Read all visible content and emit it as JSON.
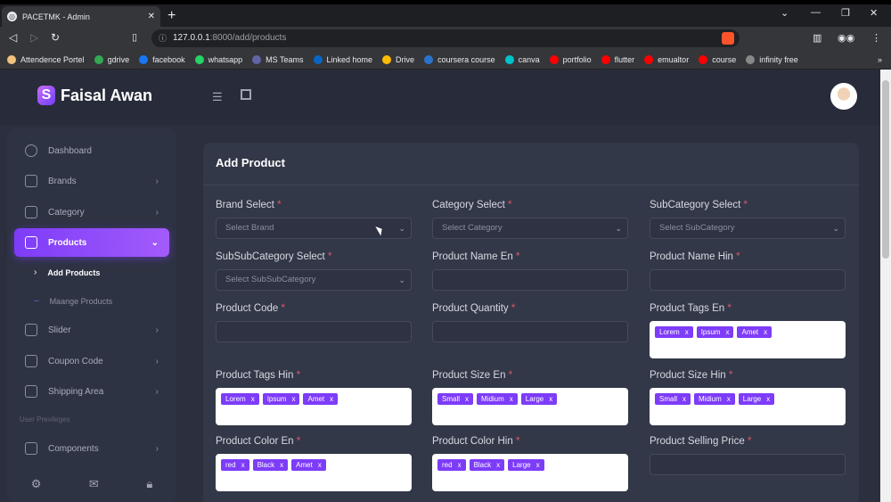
{
  "browser": {
    "tab_title": "PACETMK - Admin",
    "tab_close": "✕",
    "new_tab": "+",
    "url_host": "127.0.0.1",
    "url_path": ":8000/add/products",
    "bookmarks": [
      {
        "label": "Attendence Portel",
        "color": "#f0c27b"
      },
      {
        "label": "gdrive",
        "color": "#34a853"
      },
      {
        "label": "facebook",
        "color": "#1877f2"
      },
      {
        "label": "whatsapp",
        "color": "#25d366"
      },
      {
        "label": "MS Teams",
        "color": "#6264a7"
      },
      {
        "label": "Linked home",
        "color": "#0a66c2"
      },
      {
        "label": "Drive",
        "color": "#fbbc04"
      },
      {
        "label": "coursera course",
        "color": "#2a73cc"
      },
      {
        "label": "canva",
        "color": "#00c4cc"
      },
      {
        "label": "portfolio",
        "color": "#ff0000"
      },
      {
        "label": "flutter",
        "color": "#ff0000"
      },
      {
        "label": "emualtor",
        "color": "#ff0000"
      },
      {
        "label": "course",
        "color": "#ff0000"
      },
      {
        "label": "infinity free",
        "color": "#888888"
      }
    ],
    "more": "»"
  },
  "header": {
    "brand": "Faisal Awan",
    "logo_letter": "S"
  },
  "sidebar": {
    "items": [
      {
        "label": "Dashboard"
      },
      {
        "label": "Brands"
      },
      {
        "label": "Category"
      },
      {
        "label": "Products"
      },
      {
        "label": "Slider"
      },
      {
        "label": "Coupon Code"
      },
      {
        "label": "Shipping Area"
      },
      {
        "label": "Components"
      }
    ],
    "sub_items": [
      "Add Products",
      "Maange Products"
    ],
    "section_label": "User Previleges"
  },
  "form": {
    "title": "Add Product",
    "required_mark": "*",
    "brand_label": "Brand Select",
    "brand_placeholder": "Select Brand",
    "category_label": "Category Select",
    "category_placeholder": "Select Category",
    "subcategory_label": "SubCategory Select",
    "subcategory_placeholder": "Select SubCategory",
    "subsubcategory_label": "SubSubCategory Select",
    "subsubcategory_placeholder": "Select SubSubCategory",
    "name_en_label": "Product Name En",
    "name_hin_label": "Product Name Hin",
    "code_label": "Product Code",
    "quantity_label": "Product Quantity",
    "tags_en_label": "Product Tags En",
    "tags_en": [
      "Lorem",
      "Ipsum",
      "Amet"
    ],
    "tags_hin_label": "Product Tags Hin",
    "tags_hin": [
      "Lorem",
      "Ipsum",
      "Amet"
    ],
    "size_en_label": "Product Size En",
    "size_en": [
      "Small",
      "Midium",
      "Large"
    ],
    "size_hin_label": "Product Size Hin",
    "size_hin": [
      "Small",
      "Midium",
      "Large"
    ],
    "color_en_label": "Product Color En",
    "color_en": [
      "red",
      "Black",
      "Amet"
    ],
    "color_hin_label": "Product Color Hin",
    "color_hin": [
      "red",
      "Black",
      "Large"
    ],
    "selling_price_label": "Product Selling Price",
    "tag_remove": "x"
  }
}
